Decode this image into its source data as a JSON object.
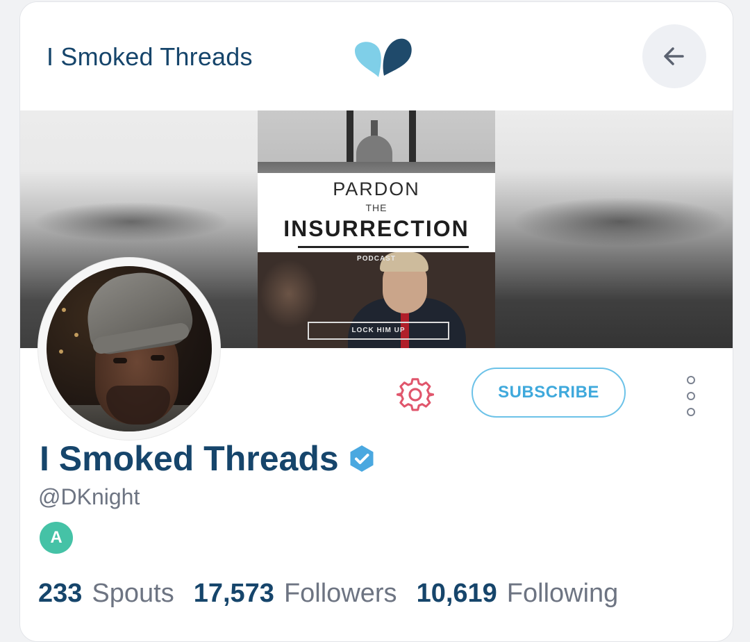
{
  "header": {
    "title": "I Smoked Threads",
    "logo_icon": "spout-logo-icon",
    "back_icon": "arrow-left-icon"
  },
  "banner": {
    "poster": {
      "line1": "PARDON",
      "line2": "THE",
      "line3": "INSURRECTION",
      "line4": "PODCAST",
      "line5": "LOCK HIM UP"
    }
  },
  "actions": {
    "settings_icon": "gear-icon",
    "subscribe_label": "SUBSCRIBE",
    "more_icon": "vertical-dots-icon"
  },
  "profile": {
    "name": "I Smoked Threads",
    "handle": "@DKnight",
    "badge_letter": "A",
    "verified_icon": "verified-check-icon"
  },
  "stats": [
    {
      "count": "233",
      "label": "Spouts"
    },
    {
      "count": "17,573",
      "label": "Followers"
    },
    {
      "count": "10,619",
      "label": "Following"
    }
  ],
  "colors": {
    "brand_dark": "#16456b",
    "brand_light_blue": "#6cc2e8",
    "subscribe_text": "#3fa9dc",
    "gear_red": "#e0566c",
    "badge_green": "#45c2a6",
    "verified_blue": "#4aa8e0",
    "muted_text": "#6d7482"
  }
}
